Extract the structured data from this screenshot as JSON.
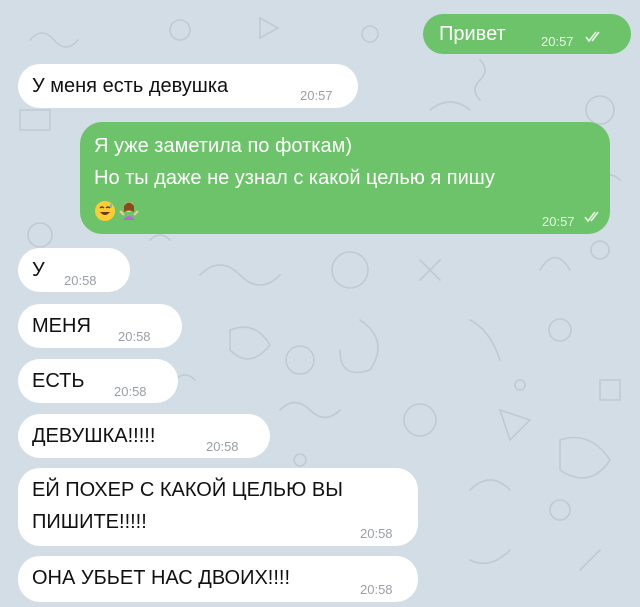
{
  "messages": [
    {
      "id": "m1",
      "direction": "out",
      "lines": [
        "Привет"
      ],
      "time": "20:57",
      "status": "read"
    },
    {
      "id": "m2",
      "direction": "in",
      "lines": [
        "У меня есть девушка"
      ],
      "time": "20:57"
    },
    {
      "id": "m3",
      "direction": "out",
      "lines": [
        "Я уже заметила по фоткам)",
        "Но ты даже не узнал с какой целью я пишу"
      ],
      "emojis": [
        "grinning-sweat-emoji",
        "woman-shrugging-emoji"
      ],
      "time": "20:57",
      "status": "read"
    },
    {
      "id": "m4",
      "direction": "in",
      "lines": [
        "У"
      ],
      "time": "20:58"
    },
    {
      "id": "m5",
      "direction": "in",
      "lines": [
        "МЕНЯ"
      ],
      "time": "20:58"
    },
    {
      "id": "m6",
      "direction": "in",
      "lines": [
        "ЕСТЬ"
      ],
      "time": "20:58"
    },
    {
      "id": "m7",
      "direction": "in",
      "lines": [
        "ДЕВУШКА!!!!!"
      ],
      "time": "20:58"
    },
    {
      "id": "m8",
      "direction": "in",
      "lines": [
        "ЕЙ ПОХЕР С КАКОЙ ЦЕЛЬЮ ВЫ",
        "ПИШИТЕ!!!!!"
      ],
      "time": "20:58"
    },
    {
      "id": "m9",
      "direction": "in",
      "lines": [
        "ОНА УБЬЕТ НАС ДВОИХ!!!!"
      ],
      "time": "20:58"
    }
  ],
  "colors": {
    "background": "#d3dde6",
    "outgoing_bubble": "#6cc36a",
    "incoming_bubble": "#ffffff"
  }
}
